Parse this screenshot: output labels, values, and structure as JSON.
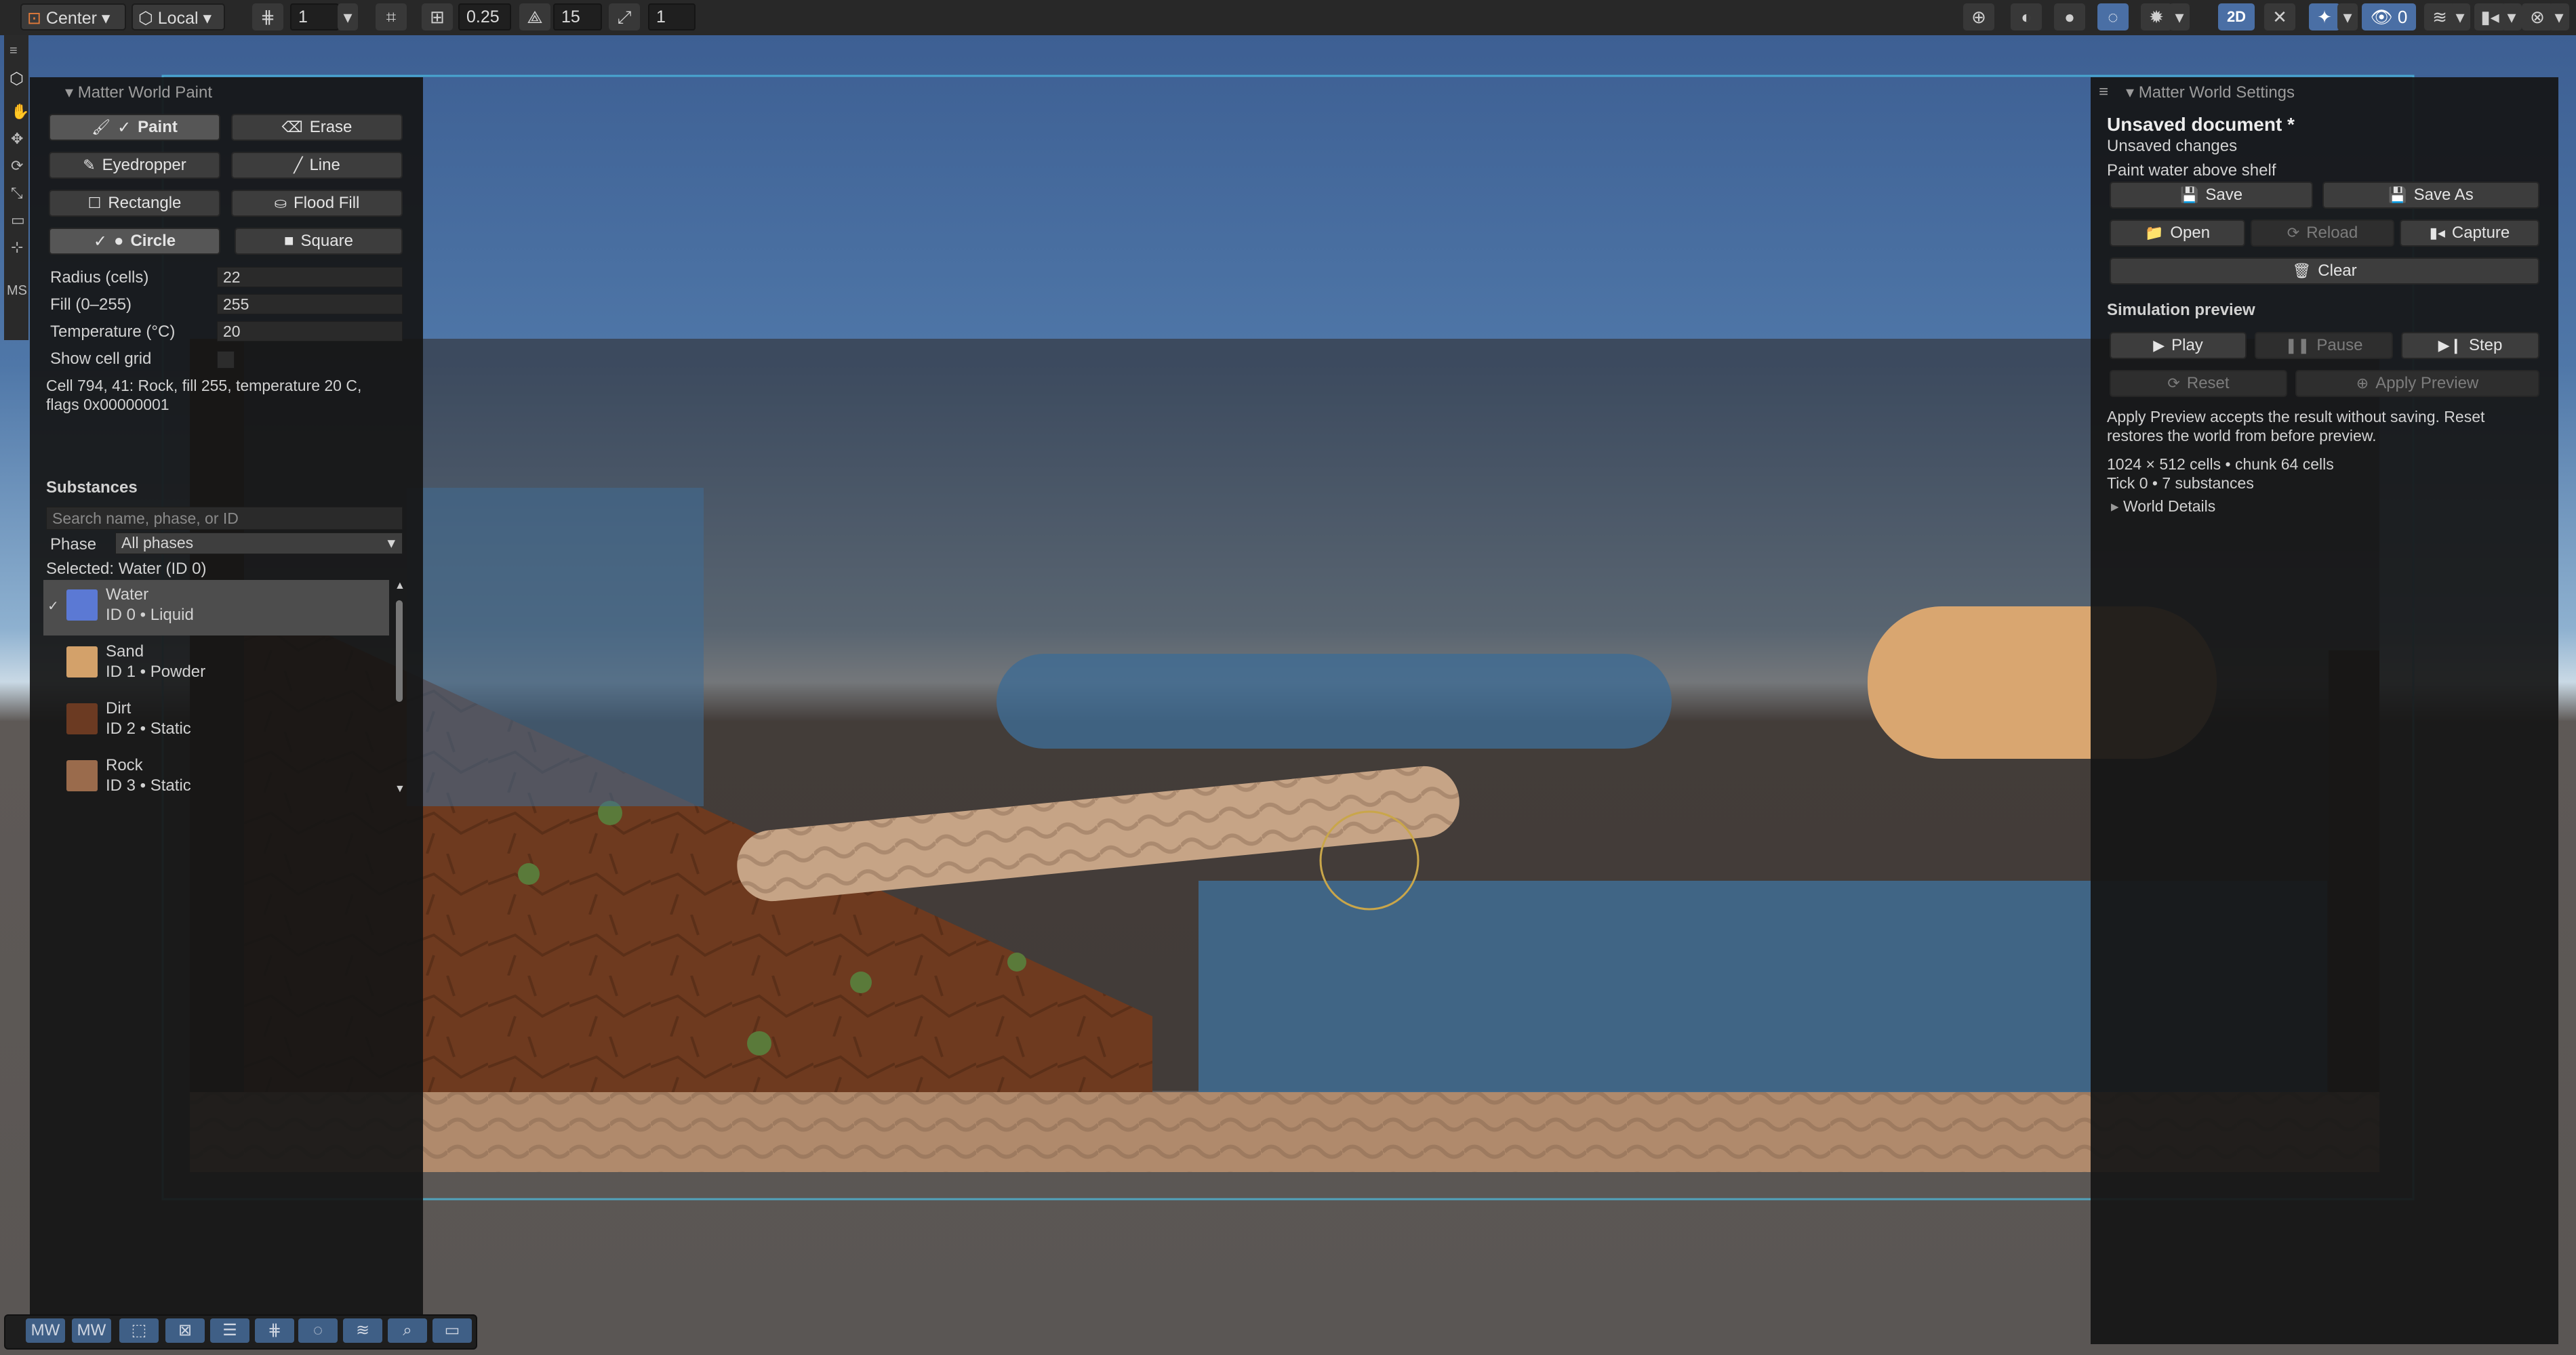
{
  "toolbar": {
    "pivot_mode": "Center",
    "pivot_rotation": "Local",
    "grid_snap_value": "1",
    "snap_increment": "0.25",
    "rotation_snap": "15",
    "scale_snap": "1",
    "view_2d_label": "2D",
    "hidden_count": "0"
  },
  "paint_panel": {
    "title": "Matter World Paint",
    "tools": [
      "Paint",
      "Erase",
      "Eyedropper",
      "Line",
      "Rectangle",
      "Flood Fill"
    ],
    "shapes": [
      "Circle",
      "Square"
    ],
    "radius_label": "Radius (cells)",
    "radius_value": "22",
    "fill_label": "Fill (0–255)",
    "fill_value": "255",
    "temperature_label": "Temperature (°C)",
    "temperature_value": "20",
    "show_cell_grid_label": "Show cell grid",
    "cell_info_line1": "Cell 794, 41: Rock, fill 255, temperature 20 C,",
    "cell_info_line2": "flags 0x00000001",
    "substances_heading": "Substances",
    "search_placeholder": "Search name, phase, or ID",
    "phase_label": "Phase",
    "phase_value": "All phases",
    "selected_label": "Selected: Water (ID 0)",
    "substances": [
      {
        "name": "Water",
        "meta": "ID 0 • Liquid",
        "color": "#5b79d4"
      },
      {
        "name": "Sand",
        "meta": "ID 1 • Powder",
        "color": "#d3a16a"
      },
      {
        "name": "Dirt",
        "meta": "ID 2 • Static",
        "color": "#6b3a22"
      },
      {
        "name": "Rock",
        "meta": "ID 3 • Static",
        "color": "#9a6b4c"
      }
    ]
  },
  "settings_panel": {
    "title": "Matter World Settings",
    "doc_title": "Unsaved document *",
    "doc_status": "Unsaved changes",
    "doc_note": "Paint water above shelf",
    "save": "Save",
    "save_as": "Save As",
    "open": "Open",
    "reload": "Reload",
    "capture": "Capture",
    "clear": "Clear",
    "sim_heading": "Simulation preview",
    "play": "Play",
    "pause": "Pause",
    "step": "Step",
    "reset": "Reset",
    "apply_preview": "Apply Preview",
    "apply_note_line1": "Apply Preview accepts the result without saving. Reset",
    "apply_note_line2": "restores the world from before preview.",
    "stats_line1": "1024 × 512 cells • chunk 64 cells",
    "stats_line2": "Tick 0 • 7 substances",
    "world_details": "World Details"
  },
  "left_tools": {
    "label": "MS"
  },
  "bottom_toolbar": {
    "items": [
      "MW",
      "MW"
    ]
  },
  "colors": {
    "water": "#3f6c93",
    "sand": "#d9a670",
    "dirt": "#6e3a1f",
    "rock": "#b08a6c",
    "accent": "#4a6fa5",
    "world_bounds": "#4fc3e8"
  }
}
